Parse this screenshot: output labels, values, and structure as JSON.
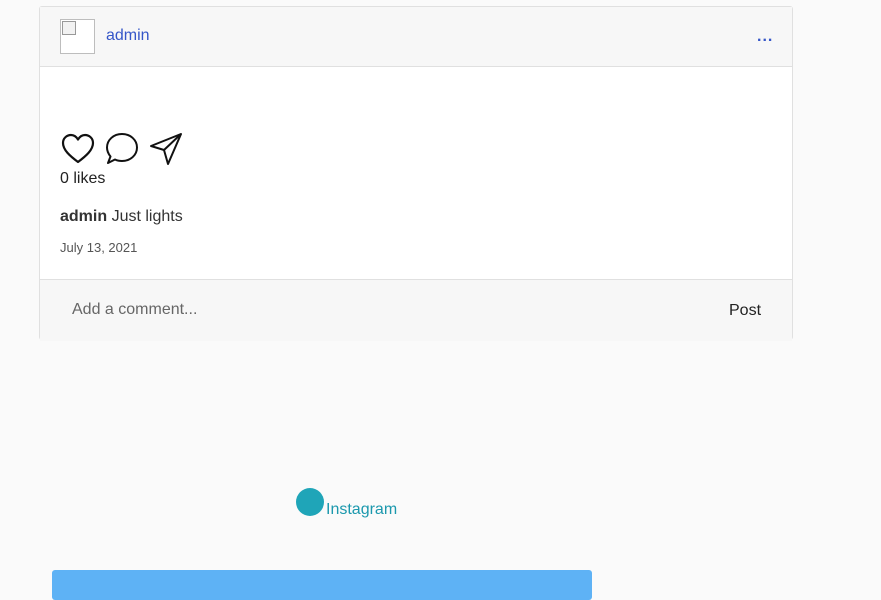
{
  "post": {
    "header": {
      "username": "admin",
      "more_label": "..."
    },
    "actions": {
      "like_icon": "heart-icon",
      "comment_icon": "comment-bubble-icon",
      "share_icon": "paper-plane-icon"
    },
    "likes_text": "0 likes",
    "caption": {
      "username": "admin",
      "text": "Just lights"
    },
    "date": "July 13, 2021",
    "comment": {
      "placeholder": "Add a comment...",
      "value": "",
      "post_label": "Post"
    }
  },
  "footer": {
    "logo_icon": "instagram-logo-icon",
    "link_label": "Instagram"
  },
  "colors": {
    "link_blue": "#3556c8",
    "teal": "#1fa5b8",
    "button_blue": "#5eb2f5"
  }
}
